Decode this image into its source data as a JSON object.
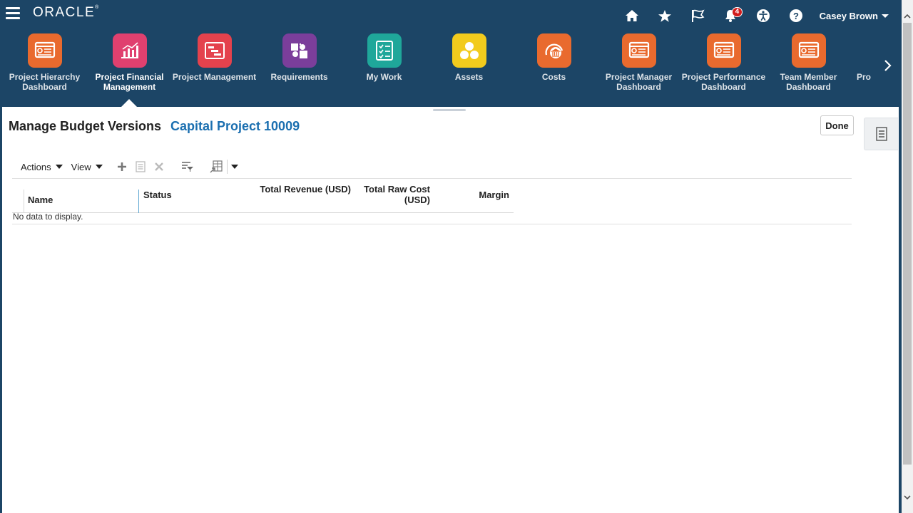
{
  "header": {
    "brand": "ORACLE",
    "brand_mark": "®",
    "user_name": "Casey Brown",
    "notification_count": "4",
    "icons": [
      "home-icon",
      "favorites-star-icon",
      "watchlist-flag-icon",
      "notifications-bell-icon",
      "accessibility-icon",
      "help-icon"
    ]
  },
  "springboard": {
    "items": [
      {
        "label": "Project Hierarchy Dashboard",
        "color": "#e96a2e",
        "icon": "dashboard-icon"
      },
      {
        "label": "Project Financial Management",
        "color": "#e0406f",
        "icon": "bar-chart-icon"
      },
      {
        "label": "Project Management",
        "color": "#e4424d",
        "icon": "gantt-icon"
      },
      {
        "label": "Requirements",
        "color": "#7b3e9b",
        "icon": "puzzle-icon"
      },
      {
        "label": "My Work",
        "color": "#1fa79a",
        "icon": "checklist-icon"
      },
      {
        "label": "Assets",
        "color": "#f2cb1d",
        "icon": "assets-icon"
      },
      {
        "label": "Costs",
        "color": "#e96a2e",
        "icon": "costs-icon"
      },
      {
        "label": "Project Manager Dashboard",
        "color": "#e96a2e",
        "icon": "dashboard-icon"
      },
      {
        "label": "Project Performance Dashboard",
        "color": "#e96a2e",
        "icon": "dashboard-icon"
      },
      {
        "label": "Team Member Dashboard",
        "color": "#e96a2e",
        "icon": "dashboard-icon"
      },
      {
        "label": "Pro",
        "color": "#e96a2e",
        "icon": "dashboard-icon"
      }
    ],
    "active_label": "Project Financial Management"
  },
  "page": {
    "title": "Manage Budget Versions",
    "subtitle": "Capital Project 10009",
    "done_label": "Done"
  },
  "toolbar": {
    "actions_label": "Actions",
    "view_label": "View"
  },
  "table": {
    "columns": [
      {
        "label": "Name"
      },
      {
        "label": "Status"
      },
      {
        "label": "Total Revenue (USD)"
      },
      {
        "label": "Total Raw Cost (USD)"
      },
      {
        "label": "Margin"
      }
    ],
    "empty_text": "No data to display."
  }
}
